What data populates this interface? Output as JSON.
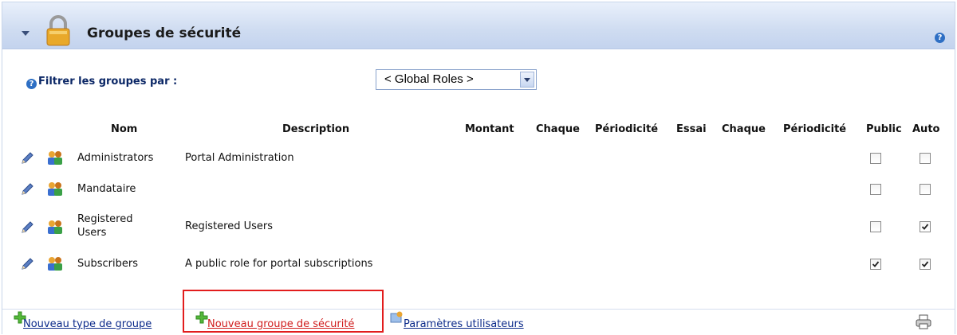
{
  "header": {
    "title": "Groupes de sécurité",
    "help_symbol": "?"
  },
  "filter": {
    "label": "Filtrer les groupes par :",
    "selected": "< Global Roles >"
  },
  "table": {
    "columns": [
      "Nom",
      "Description",
      "Montant",
      "Chaque",
      "Périodicité",
      "Essai",
      "Chaque",
      "Périodicité",
      "Public",
      "Auto"
    ],
    "rows": [
      {
        "name": "Administrators",
        "description": "Portal Administration",
        "public": false,
        "auto": false
      },
      {
        "name": "Mandataire",
        "description": "",
        "public": false,
        "auto": false
      },
      {
        "name": "Registered Users",
        "name_line1": "Registered",
        "name_line2": "Users",
        "description": "Registered Users",
        "public": false,
        "auto": true
      },
      {
        "name": "Subscribers",
        "description": "A public role for portal subscriptions",
        "public": true,
        "auto": true
      }
    ]
  },
  "footer": {
    "new_group_type": "Nouveau type de groupe",
    "new_security_group": "Nouveau groupe de sécurité",
    "user_settings": "Paramètres utilisateurs"
  },
  "colors": {
    "link": "#0b2a8a",
    "highlight": "#e21d1d",
    "header_bg": "#cfdcf1"
  },
  "icons": [
    "collapse-arrow-icon",
    "lock-icon",
    "help-icon",
    "edit-pencil-icon",
    "group-users-icon",
    "plus-icon",
    "user-settings-icon",
    "printer-icon"
  ]
}
